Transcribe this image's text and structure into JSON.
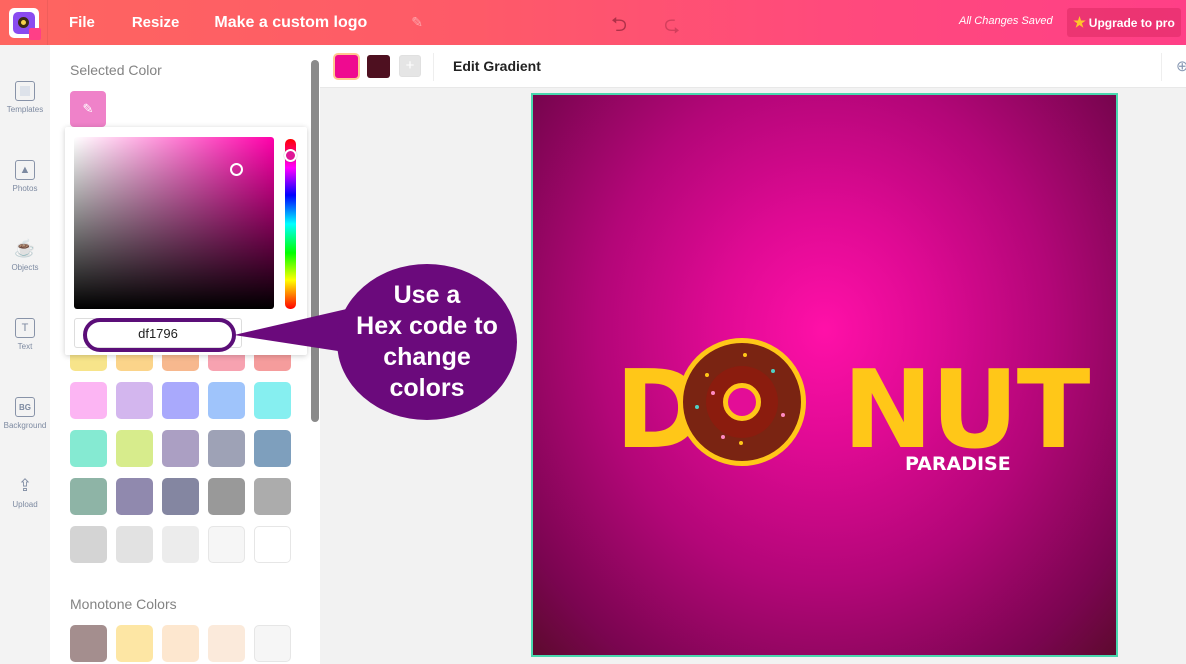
{
  "header": {
    "menu_file": "File",
    "menu_resize": "Resize",
    "doc_title": "Make a custom logo",
    "undo_icon": "undo-icon",
    "redo_icon": "redo-icon",
    "save_status": "All Changes Saved",
    "upgrade_label": "Upgrade to pro",
    "brand_color": "#ff4a7c"
  },
  "sidebar": {
    "items": [
      {
        "label": "Templates",
        "icon": "templates-icon"
      },
      {
        "label": "Photos",
        "icon": "photos-icon"
      },
      {
        "label": "Objects",
        "icon": "cup-icon"
      },
      {
        "label": "Text",
        "icon": "text-icon"
      },
      {
        "label": "Background",
        "icon": "background-icon"
      },
      {
        "label": "Upload",
        "icon": "upload-icon"
      }
    ]
  },
  "color_panel": {
    "selected_color_label": "Selected Color",
    "selected_color": "#ef82c9",
    "picker": {
      "hex_value": "df1796",
      "hue_color": "#ff00aa"
    },
    "palette_rows": [
      [
        "#f7e48a",
        "#fbd48a",
        "#f7b88e",
        "#f7a2b0",
        "#f59c9c"
      ],
      [
        "#fcb5f3",
        "#d3b6ee",
        "#a9a9fc",
        "#9fc4fb",
        "#86eff0"
      ],
      [
        "#85ead2",
        "#d7ec8c",
        "#ab9fc3",
        "#9ea2b6",
        "#7e9fbd"
      ],
      [
        "#8eb4a6",
        "#9089ae",
        "#8486a1",
        "#999999",
        "#acacac"
      ],
      [
        "#d4d4d4",
        "#e2e2e2",
        "#ececec",
        "#f6f6f6",
        "#ffffff"
      ]
    ],
    "monotone_label": "Monotone Colors",
    "monotone": [
      "#a48e8e",
      "#fde6a4",
      "#fde7cf",
      "#fbeadb",
      "#f6f6f6"
    ]
  },
  "gradient_toolbar": {
    "stops": [
      "#ef0a90",
      "#4e1020"
    ],
    "add_label": "+",
    "edit_label": "Edit Gradient"
  },
  "callout": {
    "lines": [
      "Use a",
      "Hex code to",
      "change",
      "colors"
    ],
    "color": "#6b0a7c"
  },
  "canvas": {
    "word": "D NUT",
    "word_letters": [
      "D",
      "N",
      "U",
      "T"
    ],
    "subtitle": "PARADISE",
    "accent_color": "#ffc718",
    "selection_color": "#49d8ae"
  }
}
